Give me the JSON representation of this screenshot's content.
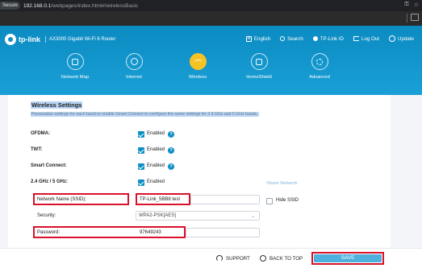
{
  "browser": {
    "secure_label": "Secure",
    "url_host": "192.168.0.1",
    "url_path": "/webpages/index.html#/wirelessBasic"
  },
  "header": {
    "logo_text": "tp-link",
    "model": "AX3000 Gigabit Wi-Fi 6 Router",
    "links": [
      "English",
      "Search",
      "TP-Link ID",
      "Log Out",
      "Update"
    ]
  },
  "nav": {
    "items": [
      {
        "label": "Network Map",
        "icon": "network-map-icon"
      },
      {
        "label": "Internet",
        "icon": "globe-icon"
      },
      {
        "label": "Wireless",
        "icon": "wifi-icon",
        "active": true
      },
      {
        "label": "HomeShield",
        "icon": "homeshield-icon"
      },
      {
        "label": "Advanced",
        "icon": "advanced-gear-icon"
      }
    ]
  },
  "wireless": {
    "title": "Wireless Settings",
    "description": "Personalize settings for each band or enable Smart Connect to configure the same settings for 2.4 GHz and 5 GHz bands.",
    "ofdma_label": "OFDMA:",
    "twt_label": "TWT:",
    "smart_connect_label": "Smart Connect:",
    "band_label": "2.4 GHz / 5 GHz:",
    "enabled_text": "Enabled",
    "share_network": "Share Network",
    "ssid_label": "Network Name (SSID):",
    "ssid_value": "TP-Link_5BB8 test",
    "hide_ssid": "Hide SSID",
    "security_label": "Security:",
    "security_value": "WPA2-PSK[AES]",
    "password_label": "Password:",
    "password_value": "97649243"
  },
  "footer": {
    "support": "SUPPORT",
    "back_to_top": "BACK TO TOP",
    "save": "SAVE"
  },
  "colors": {
    "brand_blue": "#0f8fc6",
    "active_nav": "#f6c324",
    "highlight_red": "#d9112a"
  }
}
